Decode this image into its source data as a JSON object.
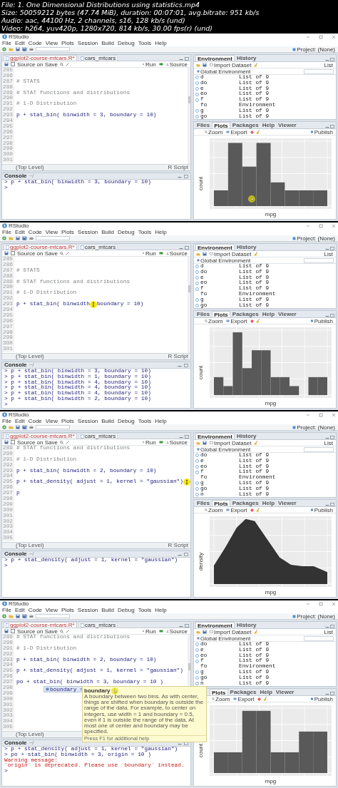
{
  "file_info": [
    "File: 1. One Dimensional Distributions using statistics.mp4",
    "Size: 50059212 bytes (47.74 MiB), duration: 00:07:01, avg.bitrate: 951 kb/s",
    "Audio: aac, 44100 Hz, 2 channels, s16, 128 kb/s (und)",
    "Video: h264, yuv420p, 1280x720, 814 kb/s, 30.00 fps(r) (und)"
  ],
  "frames": [
    {
      "title": "RStudio",
      "menu": [
        "File",
        "Edit",
        "Code",
        "View",
        "Plots",
        "Session",
        "Build",
        "Debug",
        "Tools",
        "Help"
      ],
      "project": "Project: (None)",
      "source": {
        "tabs": [
          {
            "label": "ggplot2-course-mtcars.R*",
            "selected": true,
            "modified": true
          },
          {
            "label": "cars_mtcars",
            "selected": false,
            "modified": false
          }
        ],
        "source_on_save": {
          "label": "Source on Save",
          "checked": false
        },
        "run": "Run",
        "source_button": "Source",
        "lines": [
          {
            "n": "285"
          },
          {
            "n": "286"
          },
          {
            "n": "287",
            "kind": "comment",
            "code": "# STATS"
          },
          {
            "n": "288"
          },
          {
            "n": "289",
            "kind": "comment",
            "code": "# STAT functions and distributions"
          },
          {
            "n": "290"
          },
          {
            "n": "291",
            "kind": "comment",
            "code": "# 1-D Distribution"
          },
          {
            "n": "292"
          },
          {
            "n": "293",
            "kind": "code",
            "code": "p + stat_bin( binwidth = 3, boundary = 10)"
          },
          {
            "n": "294"
          },
          {
            "n": "295"
          },
          {
            "n": "296"
          },
          {
            "n": "297"
          },
          {
            "n": "298"
          },
          {
            "n": "299"
          },
          {
            "n": "300"
          },
          {
            "n": "301"
          }
        ],
        "scope": "(Top Level)",
        "file_type": "R Script"
      },
      "console": {
        "title": "Console",
        "path": "~/",
        "lines": [
          {
            "kind": "input",
            "text": "> p + stat_bin( binwidth = 3, boundary = 10)"
          },
          {
            "kind": "input",
            "text": ">"
          }
        ]
      },
      "environment": {
        "tabs": [
          {
            "label": "Environment",
            "selected": true
          },
          {
            "label": "History",
            "selected": false
          }
        ],
        "import": "Import Dataset",
        "view": "List",
        "scope": "Global Environment",
        "rows": [
          {
            "name": "d",
            "value": "List of 9",
            "kind": "list"
          },
          {
            "name": "do",
            "value": "List of 9",
            "kind": "list"
          },
          {
            "name": "e",
            "value": "List of 9",
            "kind": "list"
          },
          {
            "name": "eo",
            "value": "List of 9",
            "kind": "list"
          },
          {
            "name": "f",
            "value": "List of 9",
            "kind": "list"
          },
          {
            "name": "fo",
            "value": "Environment",
            "kind": "environment"
          },
          {
            "name": "g",
            "value": "List of 9",
            "kind": "list"
          },
          {
            "name": "go",
            "value": "List of 9",
            "kind": "list"
          }
        ]
      },
      "plots": {
        "tabs": [
          {
            "label": "Files",
            "selected": false
          },
          {
            "label": "Plots",
            "selected": true
          },
          {
            "label": "Packages",
            "selected": false
          },
          {
            "label": "Help",
            "selected": false
          },
          {
            "label": "Viewer",
            "selected": false
          }
        ],
        "zoom": "Zoom",
        "export": "Export",
        "publish": "Publish",
        "kind": "histogram",
        "xlabel": "mpg",
        "ylabel": "count",
        "cursor_highlight": true
      }
    },
    {
      "title": "RStudio",
      "menu": [
        "File",
        "Edit",
        "Code",
        "View",
        "Plots",
        "Session",
        "Build",
        "Debug",
        "Tools",
        "Help"
      ],
      "project": "Project: (None)",
      "source": {
        "tabs": [
          {
            "label": "ggplot2-course-mtcars.R*",
            "selected": true,
            "modified": true
          },
          {
            "label": "cars_mtcars",
            "selected": false,
            "modified": false
          }
        ],
        "source_on_save": {
          "label": "Source on Save",
          "checked": false
        },
        "run": "Run",
        "source_button": "Source",
        "lines": [
          {
            "n": "285"
          },
          {
            "n": "286"
          },
          {
            "n": "287",
            "kind": "comment",
            "code": "# STATS"
          },
          {
            "n": "288"
          },
          {
            "n": "289",
            "kind": "comment",
            "code": "# STAT functions and distributions"
          },
          {
            "n": "290"
          },
          {
            "n": "291",
            "kind": "comment",
            "code": "# 1-D Distribution"
          },
          {
            "n": "292"
          },
          {
            "n": "293",
            "kind": "code",
            "code": "p + stat_bin( binwidth",
            "cursor_highlight": true,
            "code_after": "boundary = 10)"
          },
          {
            "n": "294"
          },
          {
            "n": "295"
          },
          {
            "n": "296"
          },
          {
            "n": "297"
          },
          {
            "n": "298"
          },
          {
            "n": "299"
          },
          {
            "n": "300"
          },
          {
            "n": "301"
          }
        ],
        "scope": "(Top Level)",
        "file_type": "R Script"
      },
      "console": {
        "title": "Console",
        "path": "~/",
        "lines": [
          {
            "kind": "input",
            "text": "> p + stat_bin( binwidth = 3, boundary = 10)"
          },
          {
            "kind": "input",
            "text": "> p + stat_bin( binwidth = 1, boundary = 10)"
          },
          {
            "kind": "input",
            "text": "> p + stat_bin( binwidth = 4, boundary = 10)"
          },
          {
            "kind": "input",
            "text": "> p + stat_bin( binwidth = 4, boundary = 10)"
          },
          {
            "kind": "input",
            "text": "> p + stat_bin( binwidth = 4, boundary = 10)"
          },
          {
            "kind": "input",
            "text": "> p + stat_bin( binwidth = 2, boundary = 10)"
          },
          {
            "kind": "input",
            "text": ">"
          }
        ]
      },
      "environment": {
        "tabs": [
          {
            "label": "Environment",
            "selected": true
          },
          {
            "label": "History",
            "selected": false
          }
        ],
        "import": "Import Dataset",
        "view": "List",
        "scope": "Global Environment",
        "rows": [
          {
            "name": "d",
            "value": "List of 9",
            "kind": "list"
          },
          {
            "name": "do",
            "value": "List of 9",
            "kind": "list"
          },
          {
            "name": "e",
            "value": "List of 9",
            "kind": "list"
          },
          {
            "name": "eo",
            "value": "List of 9",
            "kind": "list"
          },
          {
            "name": "f",
            "value": "List of 9",
            "kind": "list"
          },
          {
            "name": "fo",
            "value": "Environment",
            "kind": "environment"
          },
          {
            "name": "g",
            "value": "List of 9",
            "kind": "list"
          },
          {
            "name": "go",
            "value": "List of 9",
            "kind": "list"
          }
        ]
      },
      "plots": {
        "tabs": [
          {
            "label": "Files",
            "selected": false
          },
          {
            "label": "Plots",
            "selected": true
          },
          {
            "label": "Packages",
            "selected": false
          },
          {
            "label": "Help",
            "selected": false
          },
          {
            "label": "Viewer",
            "selected": false
          }
        ],
        "zoom": "Zoom",
        "export": "Export",
        "publish": "Publish",
        "kind": "histogram",
        "xlabel": "mpg",
        "ylabel": "count"
      }
    },
    {
      "title": "RStudio",
      "menu": [
        "File",
        "Edit",
        "Code",
        "View",
        "Plots",
        "Session",
        "Build",
        "Debug",
        "Tools",
        "Help"
      ],
      "project": "Project: (None)",
      "source": {
        "tabs": [
          {
            "label": "ggplot2-course-mtcars.R*",
            "selected": true,
            "modified": true
          },
          {
            "label": "cars_mtcars",
            "selected": false,
            "modified": false
          }
        ],
        "source_on_save": {
          "label": "Source on Save",
          "checked": false
        },
        "run": "Run",
        "source_button": "Source",
        "lines": [
          {
            "n": "289",
            "kind": "comment",
            "code": "# STAT functions and distributions"
          },
          {
            "n": "290"
          },
          {
            "n": "291",
            "kind": "comment",
            "code": "# 1-D Distribution"
          },
          {
            "n": "292"
          },
          {
            "n": "293",
            "kind": "code",
            "code": "p + stat_bin( binwidth = 2, boundary = 10)"
          },
          {
            "n": "294"
          },
          {
            "n": "295",
            "kind": "code",
            "code": "p + stat_density( adjust = 1, kernel = \"gaussian\")",
            "cursor_highlight": true
          },
          {
            "n": "296"
          },
          {
            "n": "297",
            "kind": "code",
            "code": "p"
          },
          {
            "n": "298"
          },
          {
            "n": "299"
          },
          {
            "n": "300"
          },
          {
            "n": "301"
          },
          {
            "n": "302"
          },
          {
            "n": "303"
          },
          {
            "n": "304"
          },
          {
            "n": "305"
          }
        ],
        "scope": "(Top Level)",
        "file_type": "R Script"
      },
      "console": {
        "title": "Console",
        "path": "~/",
        "lines": [
          {
            "kind": "input",
            "text": "> p + stat_density( adjust = 1, kernel = \"gaussian\")"
          },
          {
            "kind": "input",
            "text": ">"
          }
        ]
      },
      "environment": {
        "tabs": [
          {
            "label": "Environment",
            "selected": true
          },
          {
            "label": "History",
            "selected": false
          }
        ],
        "import": "Import Dataset",
        "view": "List",
        "scope": "Global Environment",
        "rows": [
          {
            "name": "do",
            "value": "List of 9",
            "kind": "list"
          },
          {
            "name": "e",
            "value": "List of 9",
            "kind": "list"
          },
          {
            "name": "eo",
            "value": "List of 9",
            "kind": "list"
          },
          {
            "name": "f",
            "value": "List of 9",
            "kind": "list"
          },
          {
            "name": "fo",
            "value": "Environment",
            "kind": "environment"
          },
          {
            "name": "g",
            "value": "List of 9",
            "kind": "list"
          },
          {
            "name": "go",
            "value": "List of 9",
            "kind": "list"
          },
          {
            "name": "n",
            "value": "List of 9",
            "kind": "list"
          }
        ]
      },
      "plots": {
        "tabs": [
          {
            "label": "Files",
            "selected": false
          },
          {
            "label": "Plots",
            "selected": true
          },
          {
            "label": "Packages",
            "selected": false
          },
          {
            "label": "Help",
            "selected": false
          },
          {
            "label": "Viewer",
            "selected": false
          }
        ],
        "zoom": "Zoom",
        "export": "Export",
        "publish": "Publish",
        "kind": "density",
        "xlabel": "mpg",
        "ylabel": "density"
      }
    },
    {
      "title": "RStudio",
      "menu": [
        "File",
        "Edit",
        "Code",
        "View",
        "Plots",
        "Session",
        "Build",
        "Debug",
        "Tools",
        "Help"
      ],
      "project": "Project: (None)",
      "source": {
        "tabs": [
          {
            "label": "ggplot2-course-mtcars.R*",
            "selected": true,
            "modified": true
          },
          {
            "label": "cars_mtcars",
            "selected": false,
            "modified": false
          }
        ],
        "source_on_save": {
          "label": "Source on Save",
          "checked": false
        },
        "run": "Run",
        "source_button": "Source",
        "lines": [
          {
            "n": "289",
            "kind": "comment",
            "code": "# STAT functions and distributions"
          },
          {
            "n": "290"
          },
          {
            "n": "291",
            "kind": "comment",
            "code": "# 1-D Distribution"
          },
          {
            "n": "292"
          },
          {
            "n": "293",
            "kind": "code",
            "code": "p + stat_bin( binwidth = 2, boundary = 10)"
          },
          {
            "n": "294"
          },
          {
            "n": "295",
            "kind": "code",
            "code": "p + stat_density( adjust = 1, kernel = \"gaussian\")"
          },
          {
            "n": "296"
          },
          {
            "n": "297",
            "kind": "code",
            "code": "po + stat_bin( binwidth = 3, boundary = 10 )"
          },
          {
            "n": "298"
          },
          {
            "n": "299"
          },
          {
            "n": "300"
          },
          {
            "n": "301"
          },
          {
            "n": "302"
          },
          {
            "n": "303"
          },
          {
            "n": "304"
          },
          {
            "n": "305"
          }
        ],
        "scope": "(Top Level)",
        "completion": {
          "item": "boundary =",
          "tooltip_title": "boundary",
          "tooltip_text": "A boundary between two bins. As with center, things are shifted when boundary is outside the range of the data. For example, to center on integers, use width = 1 and boundary = 0.5, even if 1 is outside the range of the data. At most one of center and boundary may be specified.",
          "tooltip_footer": "Press F1 for additional help",
          "cursor_highlight": true
        }
      },
      "console": {
        "title": "Console",
        "path": "~/",
        "lines": [
          {
            "kind": "input",
            "text": "> p + stat_density( adjust = 1, kernel = \"gaussian\")"
          },
          {
            "kind": "input",
            "text": "> po + stat_bin( binwidth = 3, origin = 10 )"
          },
          {
            "kind": "warning",
            "text": "Warning message:"
          },
          {
            "kind": "warning",
            "text": "`origin` is deprecated. Please use `boundary` instead."
          },
          {
            "kind": "input",
            "text": ">"
          }
        ]
      },
      "environment": {
        "tabs": [
          {
            "label": "Environment",
            "selected": true
          },
          {
            "label": "History",
            "selected": false
          }
        ],
        "import": "Import Dataset",
        "view": "List",
        "scope": "Global Environment",
        "rows": [
          {
            "name": "do",
            "value": "List of 9",
            "kind": "list"
          },
          {
            "name": "e",
            "value": "List of 9",
            "kind": "list"
          },
          {
            "name": "eo",
            "value": "List of 9",
            "kind": "list"
          },
          {
            "name": "f",
            "value": "List of 9",
            "kind": "list"
          },
          {
            "name": "fo",
            "value": "Environment",
            "kind": "environment"
          },
          {
            "name": "g",
            "value": "List of 9",
            "kind": "list"
          },
          {
            "name": "go",
            "value": "List of 9",
            "kind": "list"
          },
          {
            "name": "n",
            "value": "List of 9",
            "kind": "list"
          }
        ]
      },
      "plots": {
        "tabs": [
          {
            "label": "Plots",
            "selected": true
          },
          {
            "label": "Packages",
            "selected": false
          },
          {
            "label": "Help",
            "selected": false
          },
          {
            "label": "Viewer",
            "selected": false
          }
        ],
        "zoom": "Zoom",
        "export": "Export",
        "publish": "Publish",
        "kind": "histogram",
        "xlabel": "mpg",
        "ylabel": "count"
      }
    }
  ]
}
